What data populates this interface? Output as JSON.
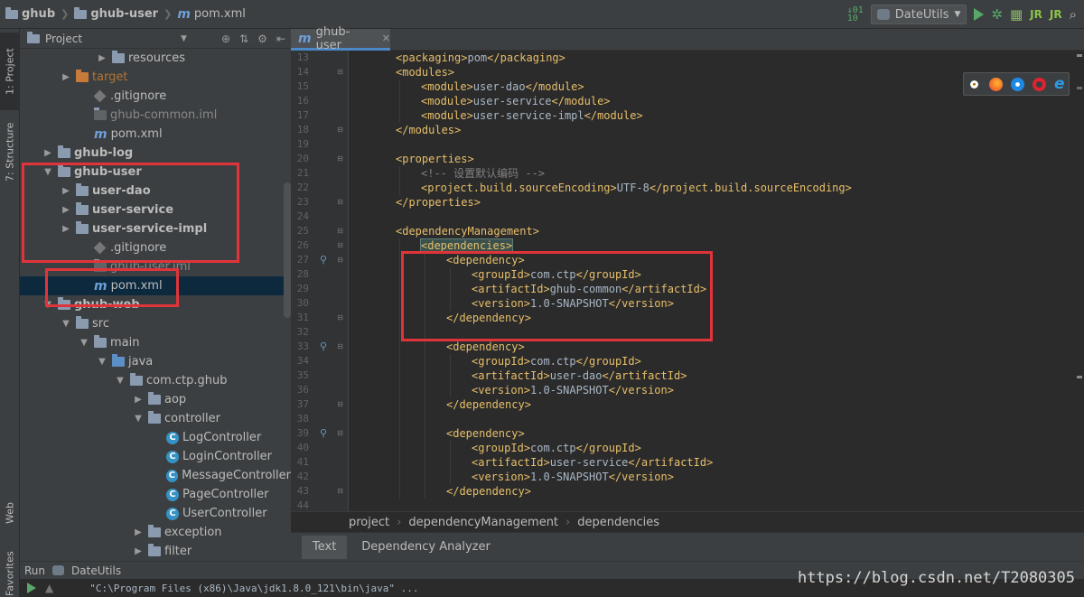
{
  "breadcrumb": {
    "items": [
      "ghub",
      "ghub-user",
      "pom.xml"
    ]
  },
  "toolbar": {
    "run_config": "DateUtils"
  },
  "sidebar_tabs": {
    "project": "1: Project",
    "structure": "7: Structure",
    "web": "Web",
    "favorites": "Favorites"
  },
  "project_panel": {
    "title": "Project"
  },
  "tree": [
    {
      "label": "resources",
      "indent": 4,
      "arrow": "right",
      "icon": "folder-res"
    },
    {
      "label": "target",
      "indent": 2,
      "arrow": "right",
      "icon": "folder-orange",
      "style": "orange"
    },
    {
      "label": ".gitignore",
      "indent": 3,
      "arrow": "",
      "icon": "git"
    },
    {
      "label": "ghub-common.iml",
      "indent": 3,
      "arrow": "",
      "icon": "iml",
      "style": "dim"
    },
    {
      "label": "pom.xml",
      "indent": 3,
      "arrow": "",
      "icon": "maven"
    },
    {
      "label": "ghub-log",
      "indent": 1,
      "arrow": "right",
      "icon": "folder",
      "style": "bold"
    },
    {
      "label": "ghub-user",
      "indent": 1,
      "arrow": "down",
      "icon": "folder",
      "style": "bold"
    },
    {
      "label": "user-dao",
      "indent": 2,
      "arrow": "right",
      "icon": "folder",
      "style": "bold"
    },
    {
      "label": "user-service",
      "indent": 2,
      "arrow": "right",
      "icon": "folder",
      "style": "bold"
    },
    {
      "label": "user-service-impl",
      "indent": 2,
      "arrow": "right",
      "icon": "folder",
      "style": "bold"
    },
    {
      "label": ".gitignore",
      "indent": 3,
      "arrow": "",
      "icon": "git"
    },
    {
      "label": "ghub-user.iml",
      "indent": 3,
      "arrow": "",
      "icon": "iml",
      "style": "dim"
    },
    {
      "label": "pom.xml",
      "indent": 3,
      "arrow": "",
      "icon": "maven",
      "selected": true
    },
    {
      "label": "ghub-web",
      "indent": 1,
      "arrow": "down",
      "icon": "folder",
      "style": "bold"
    },
    {
      "label": "src",
      "indent": 2,
      "arrow": "down",
      "icon": "folder"
    },
    {
      "label": "main",
      "indent": 3,
      "arrow": "down",
      "icon": "folder"
    },
    {
      "label": "java",
      "indent": 4,
      "arrow": "down",
      "icon": "folder-blue"
    },
    {
      "label": "com.ctp.ghub",
      "indent": 5,
      "arrow": "down",
      "icon": "folder"
    },
    {
      "label": "aop",
      "indent": 6,
      "arrow": "right",
      "icon": "folder"
    },
    {
      "label": "controller",
      "indent": 6,
      "arrow": "down",
      "icon": "folder"
    },
    {
      "label": "LogController",
      "indent": 7,
      "arrow": "",
      "icon": "class"
    },
    {
      "label": "LoginController",
      "indent": 7,
      "arrow": "",
      "icon": "class"
    },
    {
      "label": "MessageController",
      "indent": 7,
      "arrow": "",
      "icon": "class"
    },
    {
      "label": "PageController",
      "indent": 7,
      "arrow": "",
      "icon": "class"
    },
    {
      "label": "UserController",
      "indent": 7,
      "arrow": "",
      "icon": "class"
    },
    {
      "label": "exception",
      "indent": 6,
      "arrow": "right",
      "icon": "folder"
    },
    {
      "label": "filter",
      "indent": 6,
      "arrow": "right",
      "icon": "folder"
    }
  ],
  "editor": {
    "tab_label": "ghub-user",
    "lines": [
      {
        "n": "13",
        "indent": 1,
        "parts": [
          [
            "tag",
            "<packaging>"
          ],
          [
            "txt",
            "pom"
          ],
          [
            "tag",
            "</packaging>"
          ]
        ]
      },
      {
        "n": "14",
        "indent": 1,
        "fold": true,
        "parts": [
          [
            "tag",
            "<modules>"
          ]
        ]
      },
      {
        "n": "15",
        "indent": 2,
        "parts": [
          [
            "tag",
            "<module>"
          ],
          [
            "txt",
            "user-dao"
          ],
          [
            "tag",
            "</module>"
          ]
        ]
      },
      {
        "n": "16",
        "indent": 2,
        "parts": [
          [
            "tag",
            "<module>"
          ],
          [
            "txt",
            "user-service"
          ],
          [
            "tag",
            "</module>"
          ]
        ]
      },
      {
        "n": "17",
        "indent": 2,
        "parts": [
          [
            "tag",
            "<module>"
          ],
          [
            "txt",
            "user-service-impl"
          ],
          [
            "tag",
            "</module>"
          ]
        ]
      },
      {
        "n": "18",
        "indent": 1,
        "fold": true,
        "parts": [
          [
            "tag",
            "</modules>"
          ]
        ]
      },
      {
        "n": "19",
        "indent": 0,
        "parts": []
      },
      {
        "n": "20",
        "indent": 1,
        "fold": true,
        "parts": [
          [
            "tag",
            "<properties>"
          ]
        ]
      },
      {
        "n": "21",
        "indent": 2,
        "parts": [
          [
            "cm",
            "<!-- 设置默认编码 -->"
          ]
        ]
      },
      {
        "n": "22",
        "indent": 2,
        "parts": [
          [
            "tag",
            "<project.build.sourceEncoding>"
          ],
          [
            "txt",
            "UTF-8"
          ],
          [
            "tag",
            "</project.build.sourceEncoding>"
          ]
        ]
      },
      {
        "n": "23",
        "indent": 1,
        "fold": true,
        "parts": [
          [
            "tag",
            "</properties>"
          ]
        ]
      },
      {
        "n": "24",
        "indent": 0,
        "parts": []
      },
      {
        "n": "25",
        "indent": 1,
        "fold": true,
        "parts": [
          [
            "tag",
            "<dependencyManagement>"
          ]
        ]
      },
      {
        "n": "26",
        "indent": 2,
        "fold": true,
        "parts": [
          [
            "hl",
            "<dependencies>"
          ]
        ]
      },
      {
        "n": "27",
        "indent": 3,
        "fold": true,
        "marker": true,
        "parts": [
          [
            "tag",
            "<dependency>"
          ]
        ]
      },
      {
        "n": "28",
        "indent": 4,
        "parts": [
          [
            "tag",
            "<groupId>"
          ],
          [
            "txt",
            "com.ctp"
          ],
          [
            "tag",
            "</groupId>"
          ]
        ]
      },
      {
        "n": "29",
        "indent": 4,
        "parts": [
          [
            "tag",
            "<artifactId>"
          ],
          [
            "txt",
            "ghub-common"
          ],
          [
            "tag",
            "</artifactId>"
          ]
        ]
      },
      {
        "n": "30",
        "indent": 4,
        "parts": [
          [
            "tag",
            "<version>"
          ],
          [
            "txt",
            "1.0-SNAPSHOT"
          ],
          [
            "tag",
            "</version>"
          ]
        ]
      },
      {
        "n": "31",
        "indent": 3,
        "fold": true,
        "parts": [
          [
            "tag",
            "</dependency>"
          ]
        ]
      },
      {
        "n": "32",
        "indent": 0,
        "parts": []
      },
      {
        "n": "33",
        "indent": 3,
        "fold": true,
        "marker": true,
        "parts": [
          [
            "tag",
            "<dependency>"
          ]
        ]
      },
      {
        "n": "34",
        "indent": 4,
        "parts": [
          [
            "tag",
            "<groupId>"
          ],
          [
            "txt",
            "com.ctp"
          ],
          [
            "tag",
            "</groupId>"
          ]
        ]
      },
      {
        "n": "35",
        "indent": 4,
        "parts": [
          [
            "tag",
            "<artifactId>"
          ],
          [
            "txt",
            "user-dao"
          ],
          [
            "tag",
            "</artifactId>"
          ]
        ]
      },
      {
        "n": "36",
        "indent": 4,
        "parts": [
          [
            "tag",
            "<version>"
          ],
          [
            "txt",
            "1.0-SNAPSHOT"
          ],
          [
            "tag",
            "</version>"
          ]
        ]
      },
      {
        "n": "37",
        "indent": 3,
        "fold": true,
        "parts": [
          [
            "tag",
            "</dependency>"
          ]
        ]
      },
      {
        "n": "38",
        "indent": 0,
        "parts": []
      },
      {
        "n": "39",
        "indent": 3,
        "fold": true,
        "marker": true,
        "parts": [
          [
            "tag",
            "<dependency>"
          ]
        ]
      },
      {
        "n": "40",
        "indent": 4,
        "parts": [
          [
            "tag",
            "<groupId>"
          ],
          [
            "txt",
            "com.ctp"
          ],
          [
            "tag",
            "</groupId>"
          ]
        ]
      },
      {
        "n": "41",
        "indent": 4,
        "parts": [
          [
            "tag",
            "<artifactId>"
          ],
          [
            "txt",
            "user-service"
          ],
          [
            "tag",
            "</artifactId>"
          ]
        ]
      },
      {
        "n": "42",
        "indent": 4,
        "parts": [
          [
            "tag",
            "<version>"
          ],
          [
            "txt",
            "1.0-SNAPSHOT"
          ],
          [
            "tag",
            "</version>"
          ]
        ]
      },
      {
        "n": "43",
        "indent": 3,
        "fold": true,
        "parts": [
          [
            "tag",
            "</dependency>"
          ]
        ]
      },
      {
        "n": "44",
        "indent": 0,
        "parts": []
      }
    ]
  },
  "xml_breadcrumb": [
    "project",
    "dependencyManagement",
    "dependencies"
  ],
  "bottom_tabs": [
    "Text",
    "Dependency Analyzer"
  ],
  "run": {
    "label": "Run",
    "config": "DateUtils",
    "console_text": "\"C:\\Program Files (x86)\\Java\\jdk1.8.0_121\\bin\\java\" ..."
  },
  "watermark": "https://blog.csdn.net/T2080305",
  "colors": {
    "accent": "#4a88c7",
    "highlight_box": "#e0343a",
    "xml_tag": "#e8bf6a"
  }
}
